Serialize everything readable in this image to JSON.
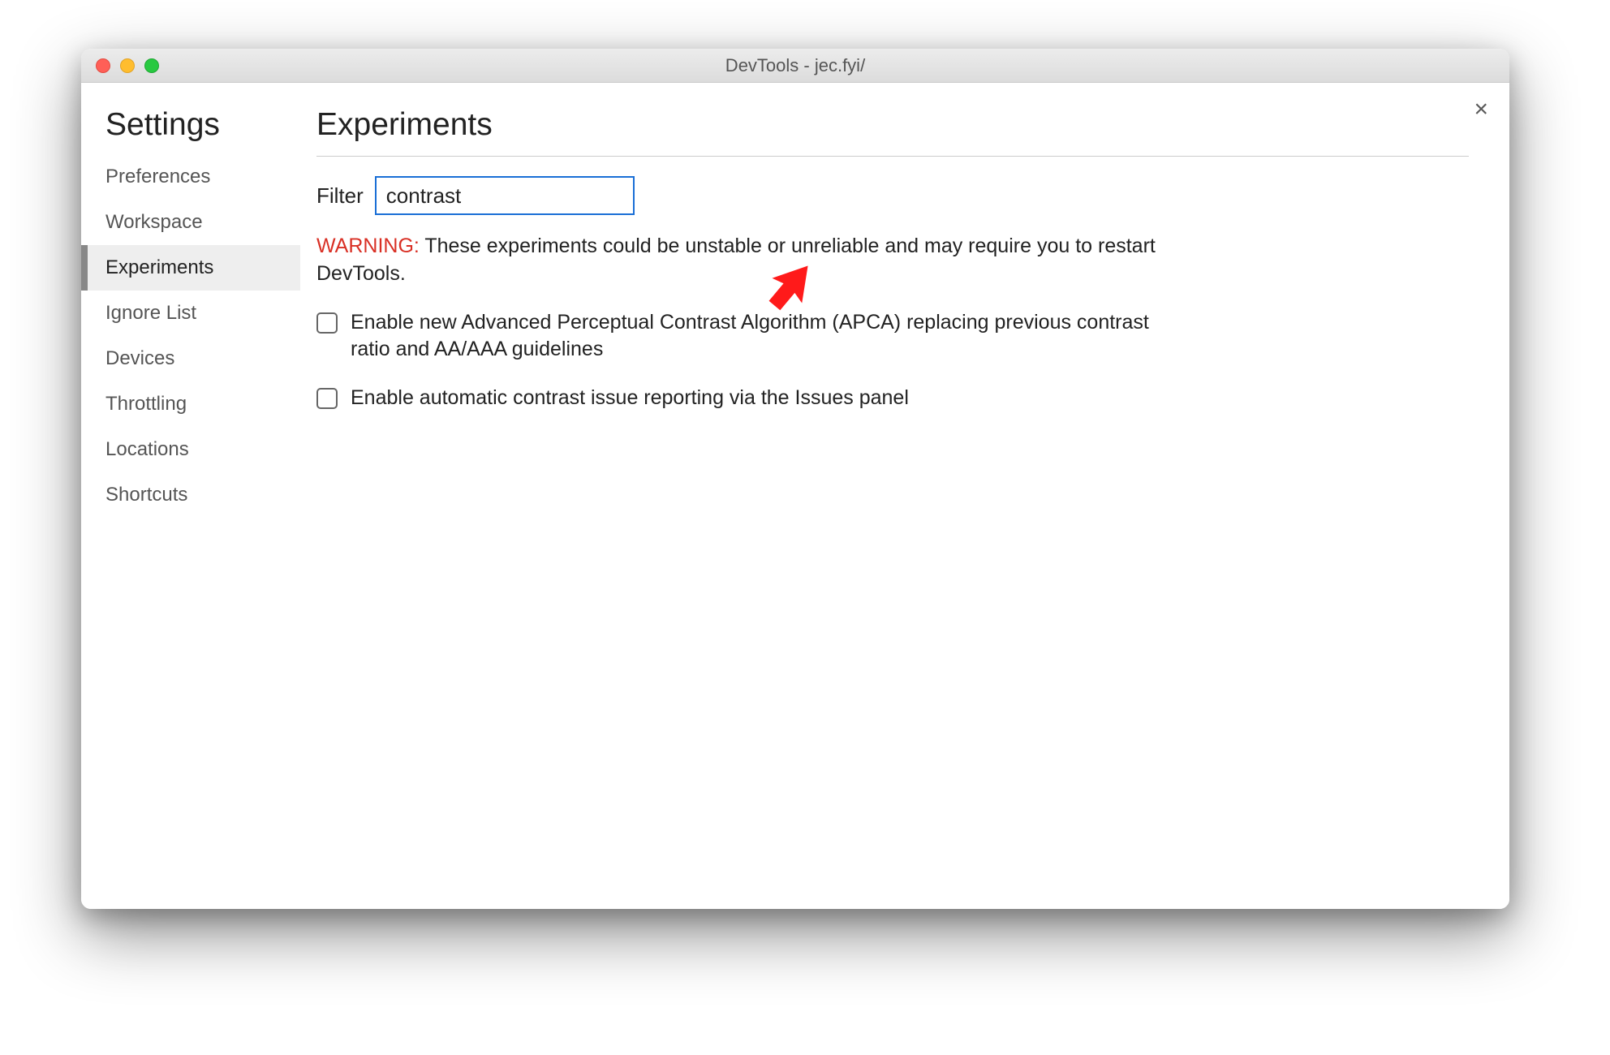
{
  "window": {
    "title": "DevTools - jec.fyi/"
  },
  "close_label": "×",
  "sidebar": {
    "title": "Settings",
    "items": [
      {
        "label": "Preferences"
      },
      {
        "label": "Workspace"
      },
      {
        "label": "Experiments"
      },
      {
        "label": "Ignore List"
      },
      {
        "label": "Devices"
      },
      {
        "label": "Throttling"
      },
      {
        "label": "Locations"
      },
      {
        "label": "Shortcuts"
      }
    ],
    "active_index": 2
  },
  "main": {
    "title": "Experiments",
    "filter_label": "Filter",
    "filter_value": "contrast",
    "warning_prefix": "WARNING:",
    "warning_text": " These experiments could be unstable or unreliable and may require you to restart DevTools.",
    "experiments": [
      {
        "label": "Enable new Advanced Perceptual Contrast Algorithm (APCA) replacing previous contrast ratio and AA/AAA guidelines",
        "checked": false
      },
      {
        "label": "Enable automatic contrast issue reporting via the Issues panel",
        "checked": false
      }
    ]
  },
  "annotation": {
    "arrow_color": "#ff1a1a"
  }
}
